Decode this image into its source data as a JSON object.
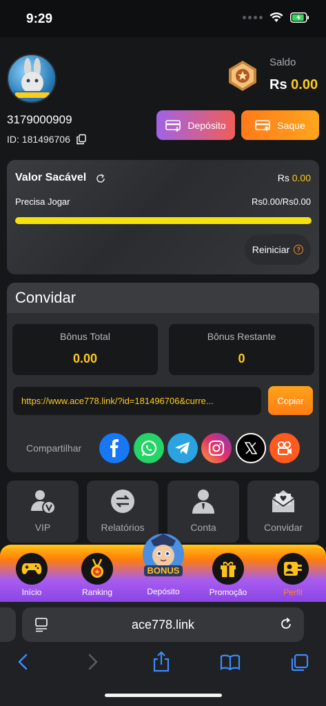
{
  "status_bar": {
    "time": "9:29"
  },
  "header": {
    "username": "3179000909",
    "user_id": "ID: 181496706",
    "balance_label": "Saldo",
    "balance_currency": "Rs",
    "balance_value": "0.00",
    "deposit_label": "Depósito",
    "withdraw_label": "Saque"
  },
  "valor_sacavel": {
    "title": "Valor Sacável",
    "amount_currency": "Rs",
    "amount_value": "0.00",
    "precisa_label": "Precisa Jogar",
    "precisa_value": "Rs0.00/Rs0.00",
    "progress_fraction": 1.0,
    "reset_label": "Reiniciar"
  },
  "convidar": {
    "title": "Convidar",
    "bonus_total_label": "Bônus Total",
    "bonus_total_value": "0.00",
    "bonus_restante_label": "Bônus Restante",
    "bonus_restante_value": "0",
    "invite_link": "https://www.ace778.link/?id=181496706&curre...",
    "copy_label": "Copiar",
    "share_label": "Compartilhar",
    "share_icons": [
      "facebook-icon",
      "whatsapp-icon",
      "telegram-icon",
      "instagram-icon",
      "x-icon",
      "kwai-icon"
    ]
  },
  "quick_links": [
    {
      "label": "VIP",
      "icon": "vip-user-icon"
    },
    {
      "label": "Relatórios",
      "icon": "transfer-icon"
    },
    {
      "label": "Conta",
      "icon": "account-icon"
    },
    {
      "label": "Convidar",
      "icon": "invite-mail-icon"
    }
  ],
  "bottom_nav": {
    "items": [
      {
        "label": "Início",
        "icon": "gamepad-icon"
      },
      {
        "label": "Ranking",
        "icon": "medal-icon"
      },
      {
        "label": "Depósito",
        "icon": "bonus-mascot-icon"
      },
      {
        "label": "Promoção",
        "icon": "gift-icon"
      },
      {
        "label": "Perfil",
        "icon": "profile-card-icon",
        "active": true
      }
    ],
    "center_badge": "BONUS"
  },
  "browser": {
    "url": "ace778.link"
  },
  "colors": {
    "accent_yellow": "#ffcc1a",
    "accent_orange": "#ff8a1a",
    "progress": "#f5e20c",
    "card_bg": "#2c2e31"
  }
}
